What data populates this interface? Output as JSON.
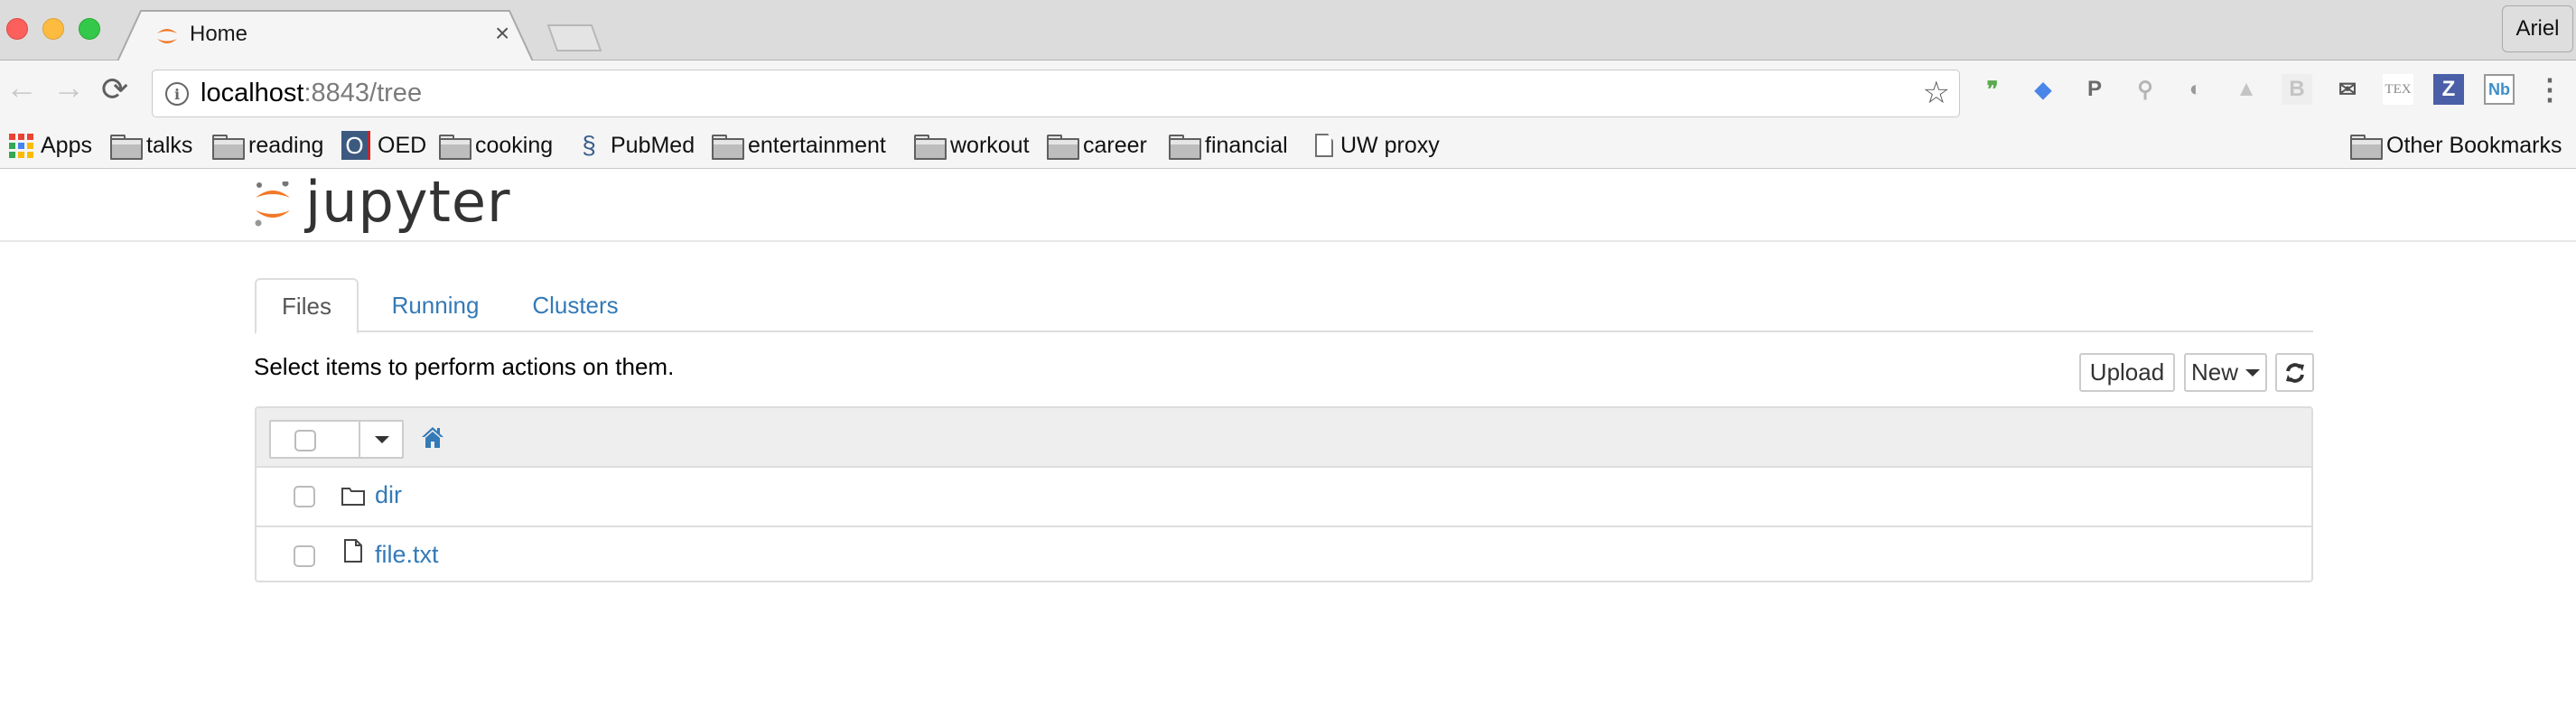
{
  "browser": {
    "tab": {
      "title": "Home",
      "favicon": "jupyter-logo-icon",
      "close": "×"
    },
    "profile_name": "Ariel",
    "nav": {
      "back": "←",
      "forward": "→",
      "reload": "⟳"
    },
    "url": {
      "host": "localhost",
      "rest": ":8843/tree"
    },
    "bookmark_star": "☆",
    "extensions": [
      {
        "name": "hangouts-icon",
        "glyph": "❞",
        "color": "#5aaa4f"
      },
      {
        "name": "google-scholar-icon",
        "glyph": "◆",
        "color": "#4a86e8"
      },
      {
        "name": "paypal-icon",
        "glyph": "P",
        "color": "#6b6b6b"
      },
      {
        "name": "github-search-icon",
        "glyph": "⚲",
        "color": "#b5b5b5"
      },
      {
        "name": "extension-shield-icon",
        "glyph": "◐",
        "color": "#9a9a9a"
      },
      {
        "name": "google-drive-icon",
        "glyph": "▲",
        "color": "#c4c4c4"
      },
      {
        "name": "bi-extension-icon",
        "glyph": "B",
        "color": "#c4c4c4"
      },
      {
        "name": "inbox-check-icon",
        "glyph": "✉",
        "color": "#555555"
      },
      {
        "name": "tex-icon",
        "glyph": "TEX",
        "color": "#8a8a8a"
      },
      {
        "name": "zotero-icon",
        "glyph": "Z",
        "color": "#ffffff"
      },
      {
        "name": "notebook-icon",
        "glyph": "Nb",
        "color": "#3d8ec9"
      },
      {
        "name": "chrome-menu-icon",
        "glyph": "⋮",
        "color": "#666666"
      }
    ],
    "bookmarks": [
      {
        "label": "Apps",
        "icon": "apps"
      },
      {
        "label": "talks",
        "icon": "folder"
      },
      {
        "label": "reading",
        "icon": "folder"
      },
      {
        "label": "OED",
        "icon": "oed"
      },
      {
        "label": "cooking",
        "icon": "folder"
      },
      {
        "label": "PubMed",
        "icon": "pubmed"
      },
      {
        "label": "entertainment",
        "icon": "folder"
      },
      {
        "label": "workout",
        "icon": "folder"
      },
      {
        "label": "career",
        "icon": "folder"
      },
      {
        "label": "financial",
        "icon": "folder"
      },
      {
        "label": "UW proxy",
        "icon": "page"
      }
    ],
    "other_bookmarks": "Other Bookmarks"
  },
  "jupyter": {
    "logo_text": "jupyter",
    "tabs": [
      {
        "label": "Files",
        "active": true
      },
      {
        "label": "Running",
        "active": false
      },
      {
        "label": "Clusters",
        "active": false
      }
    ],
    "hint": "Select items to perform actions on them.",
    "buttons": {
      "upload": "Upload",
      "new": "New",
      "refresh": "⟳"
    },
    "files": [
      {
        "name": "dir",
        "type": "directory"
      },
      {
        "name": "file.txt",
        "type": "file"
      }
    ],
    "colors": {
      "link": "#337ab7",
      "logo_orange": "#f37726"
    }
  }
}
